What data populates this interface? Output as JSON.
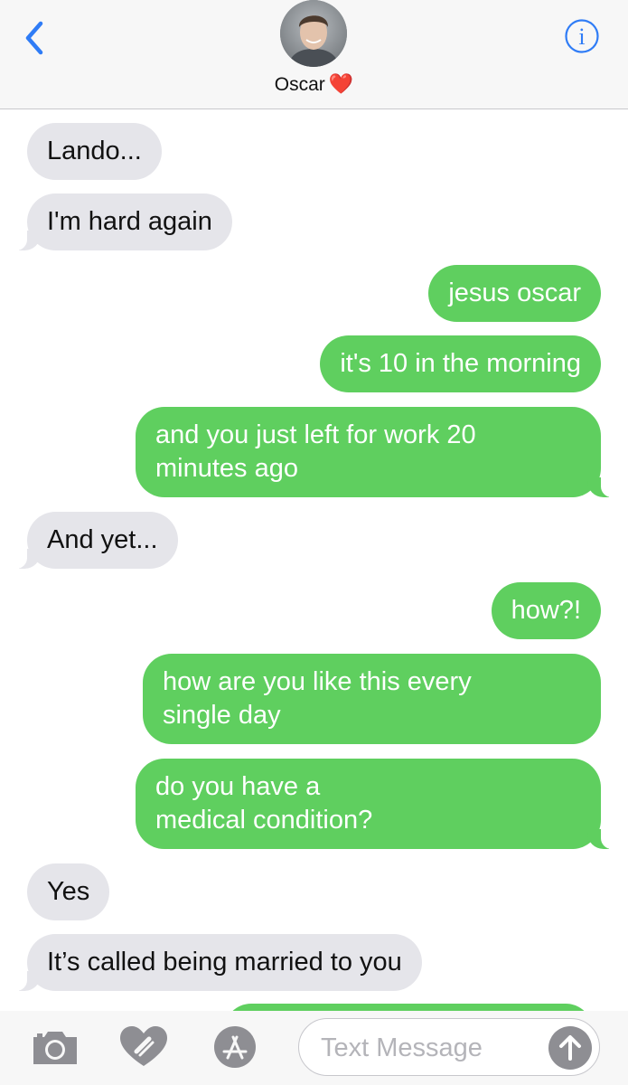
{
  "header": {
    "contact_name": "Oscar",
    "heart": "❤️",
    "back_icon": "chevron-left-icon",
    "info_icon": "info-icon",
    "accent_color": "#2f7cf6"
  },
  "messages": [
    {
      "from": "them",
      "text": "Lando..."
    },
    {
      "from": "them",
      "text": "I'm hard again"
    },
    {
      "from": "me",
      "text": "jesus oscar"
    },
    {
      "from": "me",
      "text": "it's 10 in the morning"
    },
    {
      "from": "me",
      "text": "and you just left for work 20\nminutes ago"
    },
    {
      "from": "them",
      "text": "And yet..."
    },
    {
      "from": "me",
      "text": "how?!"
    },
    {
      "from": "me",
      "text": "how are you like this every\nsingle day"
    },
    {
      "from": "me",
      "text": "do you have a\nmedical condition?"
    },
    {
      "from": "them",
      "text": "Yes"
    },
    {
      "from": "them",
      "text": "It’s called being married to you"
    }
  ],
  "colors": {
    "incoming_bubble": "#e5e5ea",
    "outgoing_bubble": "#5fcf5f"
  },
  "composer": {
    "placeholder": "Text Message",
    "camera_icon": "camera-icon",
    "digital_touch_icon": "digital-touch-heart-icon",
    "app_store_icon": "app-store-icon",
    "send_icon": "send-arrow-up-icon"
  }
}
